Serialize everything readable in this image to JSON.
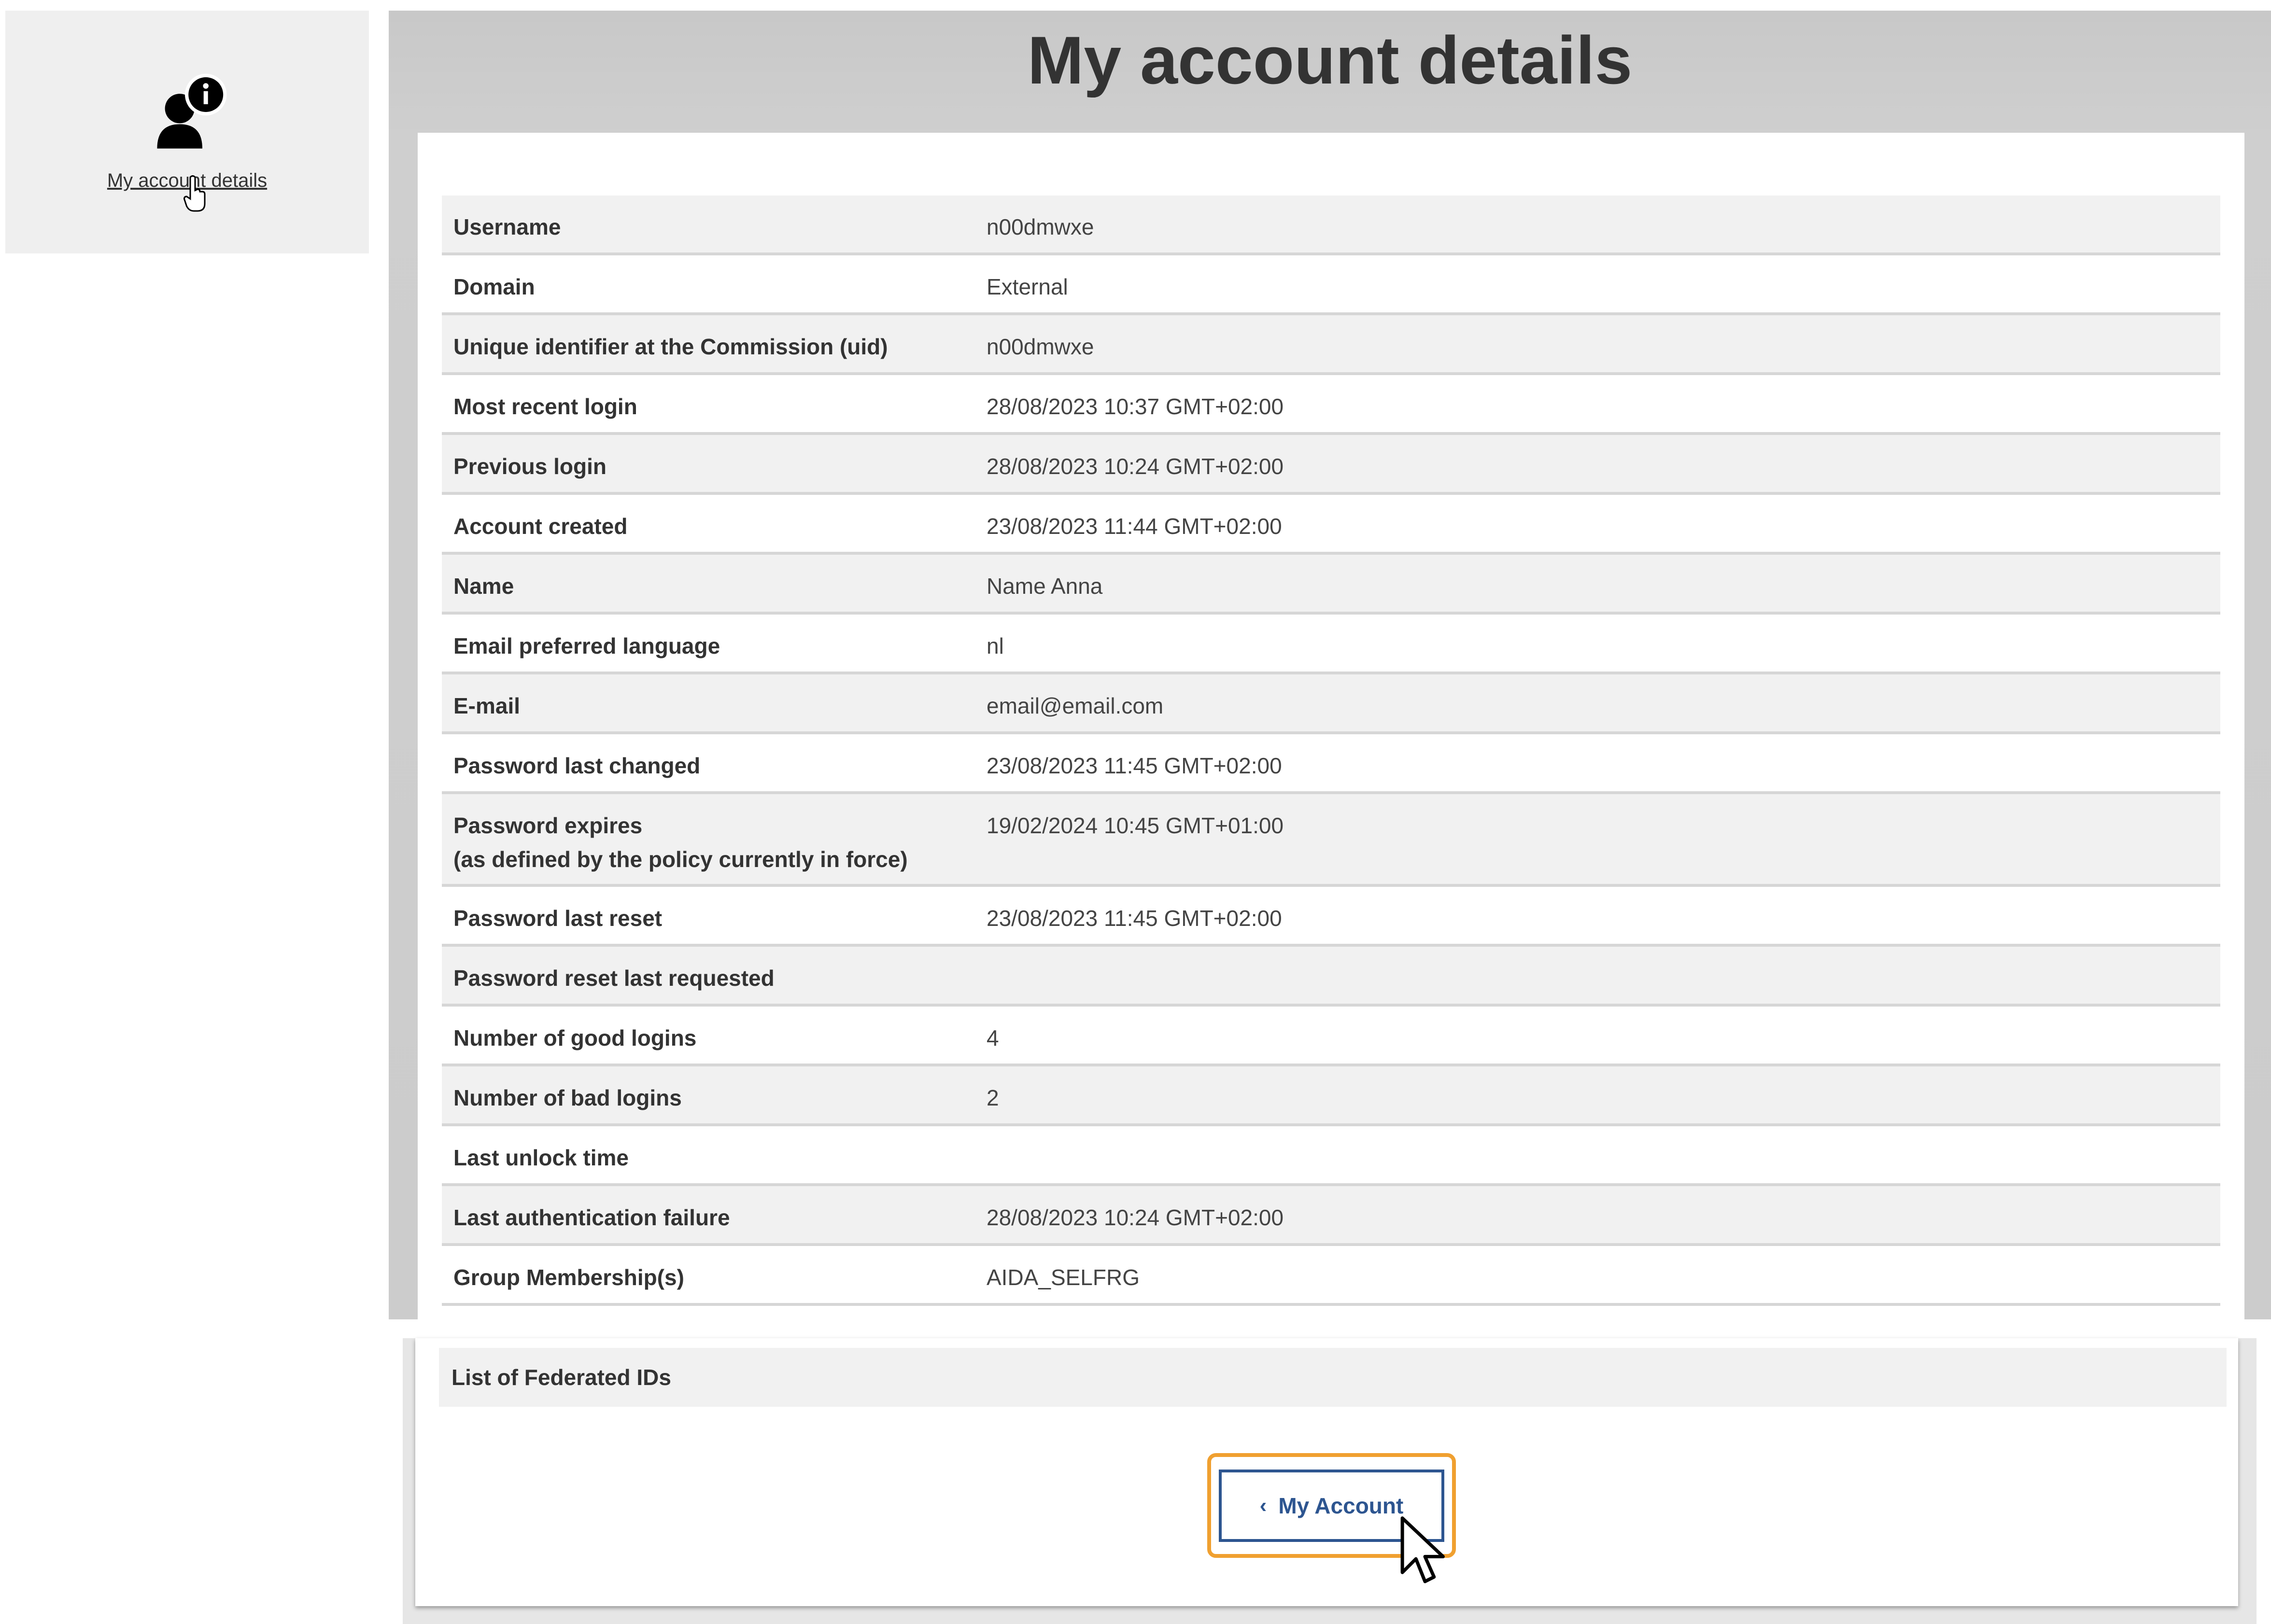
{
  "sidebar": {
    "tile_icon": "user-info-icon",
    "tile_label": "My account details"
  },
  "main": {
    "title": "My account details",
    "rows": [
      {
        "label": "Username",
        "value": "n00dmwxe"
      },
      {
        "label": "Domain",
        "value": "External"
      },
      {
        "label": "Unique identifier at the Commission (uid)",
        "value": "n00dmwxe"
      },
      {
        "label": "Most recent login",
        "value": "28/08/2023 10:37 GMT+02:00"
      },
      {
        "label": "Previous login",
        "value": "28/08/2023 10:24 GMT+02:00"
      },
      {
        "label": "Account created",
        "value": "23/08/2023 11:44 GMT+02:00"
      },
      {
        "label": "Name",
        "value": "Name Anna"
      },
      {
        "label": "Email preferred language",
        "value": "nl"
      },
      {
        "label": "E-mail",
        "value": "email@email.com"
      },
      {
        "label": "Password last changed",
        "value": "23/08/2023 11:45 GMT+02:00"
      },
      {
        "label": "Password expires\n(as defined by the policy currently in force)",
        "value": "19/02/2024 10:45 GMT+01:00"
      },
      {
        "label": "Password last reset",
        "value": "23/08/2023 11:45 GMT+02:00"
      },
      {
        "label": "Password reset last requested",
        "value": ""
      },
      {
        "label": "Number of good logins",
        "value": "4"
      },
      {
        "label": "Number of bad logins",
        "value": "2"
      },
      {
        "label": "Last unlock time",
        "value": ""
      },
      {
        "label": "Last authentication failure",
        "value": "28/08/2023 10:24 GMT+02:00"
      },
      {
        "label": "Group Membership(s)",
        "value": "AIDA_SELFRG"
      }
    ],
    "federated_label": "List of Federated IDs",
    "back_button": {
      "icon": "chevron-left-icon",
      "label": "My Account"
    }
  },
  "colors": {
    "button_border": "#2d5590",
    "focus_ring": "#f0a030",
    "header_gray": "#cccccc"
  }
}
